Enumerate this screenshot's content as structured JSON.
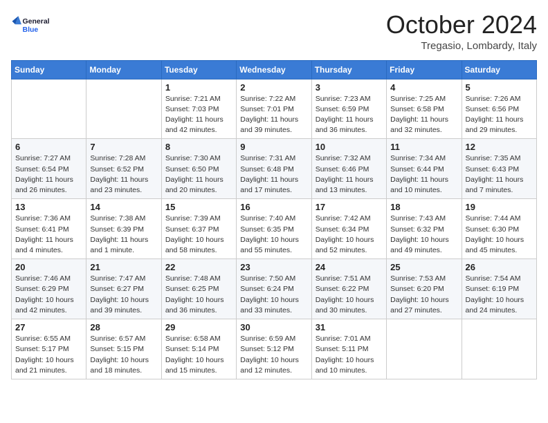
{
  "header": {
    "logo_general": "General",
    "logo_blue": "Blue",
    "month_title": "October 2024",
    "location": "Tregasio, Lombardy, Italy"
  },
  "days_of_week": [
    "Sunday",
    "Monday",
    "Tuesday",
    "Wednesday",
    "Thursday",
    "Friday",
    "Saturday"
  ],
  "weeks": [
    [
      {
        "day": "",
        "info": ""
      },
      {
        "day": "",
        "info": ""
      },
      {
        "day": "1",
        "info": "Sunrise: 7:21 AM\nSunset: 7:03 PM\nDaylight: 11 hours and 42 minutes."
      },
      {
        "day": "2",
        "info": "Sunrise: 7:22 AM\nSunset: 7:01 PM\nDaylight: 11 hours and 39 minutes."
      },
      {
        "day": "3",
        "info": "Sunrise: 7:23 AM\nSunset: 6:59 PM\nDaylight: 11 hours and 36 minutes."
      },
      {
        "day": "4",
        "info": "Sunrise: 7:25 AM\nSunset: 6:58 PM\nDaylight: 11 hours and 32 minutes."
      },
      {
        "day": "5",
        "info": "Sunrise: 7:26 AM\nSunset: 6:56 PM\nDaylight: 11 hours and 29 minutes."
      }
    ],
    [
      {
        "day": "6",
        "info": "Sunrise: 7:27 AM\nSunset: 6:54 PM\nDaylight: 11 hours and 26 minutes."
      },
      {
        "day": "7",
        "info": "Sunrise: 7:28 AM\nSunset: 6:52 PM\nDaylight: 11 hours and 23 minutes."
      },
      {
        "day": "8",
        "info": "Sunrise: 7:30 AM\nSunset: 6:50 PM\nDaylight: 11 hours and 20 minutes."
      },
      {
        "day": "9",
        "info": "Sunrise: 7:31 AM\nSunset: 6:48 PM\nDaylight: 11 hours and 17 minutes."
      },
      {
        "day": "10",
        "info": "Sunrise: 7:32 AM\nSunset: 6:46 PM\nDaylight: 11 hours and 13 minutes."
      },
      {
        "day": "11",
        "info": "Sunrise: 7:34 AM\nSunset: 6:44 PM\nDaylight: 11 hours and 10 minutes."
      },
      {
        "day": "12",
        "info": "Sunrise: 7:35 AM\nSunset: 6:43 PM\nDaylight: 11 hours and 7 minutes."
      }
    ],
    [
      {
        "day": "13",
        "info": "Sunrise: 7:36 AM\nSunset: 6:41 PM\nDaylight: 11 hours and 4 minutes."
      },
      {
        "day": "14",
        "info": "Sunrise: 7:38 AM\nSunset: 6:39 PM\nDaylight: 11 hours and 1 minute."
      },
      {
        "day": "15",
        "info": "Sunrise: 7:39 AM\nSunset: 6:37 PM\nDaylight: 10 hours and 58 minutes."
      },
      {
        "day": "16",
        "info": "Sunrise: 7:40 AM\nSunset: 6:35 PM\nDaylight: 10 hours and 55 minutes."
      },
      {
        "day": "17",
        "info": "Sunrise: 7:42 AM\nSunset: 6:34 PM\nDaylight: 10 hours and 52 minutes."
      },
      {
        "day": "18",
        "info": "Sunrise: 7:43 AM\nSunset: 6:32 PM\nDaylight: 10 hours and 49 minutes."
      },
      {
        "day": "19",
        "info": "Sunrise: 7:44 AM\nSunset: 6:30 PM\nDaylight: 10 hours and 45 minutes."
      }
    ],
    [
      {
        "day": "20",
        "info": "Sunrise: 7:46 AM\nSunset: 6:29 PM\nDaylight: 10 hours and 42 minutes."
      },
      {
        "day": "21",
        "info": "Sunrise: 7:47 AM\nSunset: 6:27 PM\nDaylight: 10 hours and 39 minutes."
      },
      {
        "day": "22",
        "info": "Sunrise: 7:48 AM\nSunset: 6:25 PM\nDaylight: 10 hours and 36 minutes."
      },
      {
        "day": "23",
        "info": "Sunrise: 7:50 AM\nSunset: 6:24 PM\nDaylight: 10 hours and 33 minutes."
      },
      {
        "day": "24",
        "info": "Sunrise: 7:51 AM\nSunset: 6:22 PM\nDaylight: 10 hours and 30 minutes."
      },
      {
        "day": "25",
        "info": "Sunrise: 7:53 AM\nSunset: 6:20 PM\nDaylight: 10 hours and 27 minutes."
      },
      {
        "day": "26",
        "info": "Sunrise: 7:54 AM\nSunset: 6:19 PM\nDaylight: 10 hours and 24 minutes."
      }
    ],
    [
      {
        "day": "27",
        "info": "Sunrise: 6:55 AM\nSunset: 5:17 PM\nDaylight: 10 hours and 21 minutes."
      },
      {
        "day": "28",
        "info": "Sunrise: 6:57 AM\nSunset: 5:15 PM\nDaylight: 10 hours and 18 minutes."
      },
      {
        "day": "29",
        "info": "Sunrise: 6:58 AM\nSunset: 5:14 PM\nDaylight: 10 hours and 15 minutes."
      },
      {
        "day": "30",
        "info": "Sunrise: 6:59 AM\nSunset: 5:12 PM\nDaylight: 10 hours and 12 minutes."
      },
      {
        "day": "31",
        "info": "Sunrise: 7:01 AM\nSunset: 5:11 PM\nDaylight: 10 hours and 10 minutes."
      },
      {
        "day": "",
        "info": ""
      },
      {
        "day": "",
        "info": ""
      }
    ]
  ]
}
